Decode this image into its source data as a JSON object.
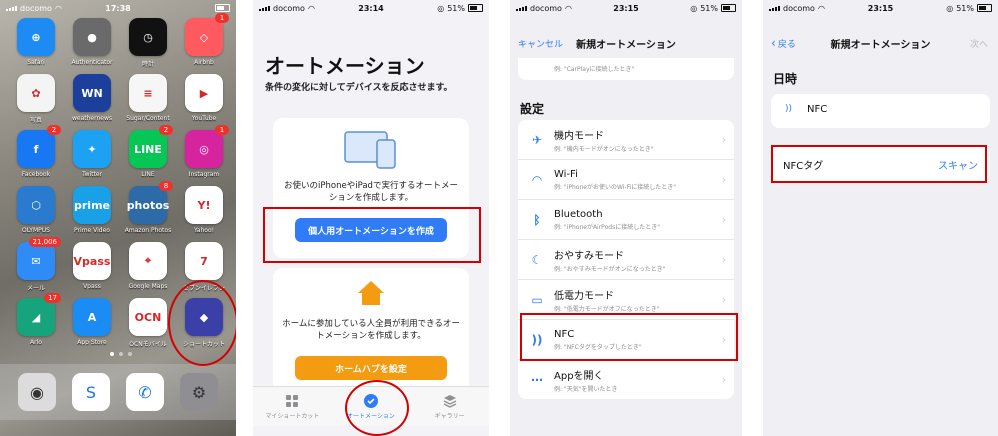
{
  "panel1": {
    "status": {
      "carrier": "docomo",
      "time": "17:38"
    },
    "apps": [
      {
        "label": "Safari",
        "icon": "compass-icon",
        "bg": "#1e8bf5",
        "glyph": "⊕"
      },
      {
        "label": "Authenticator",
        "icon": "authenticator-icon",
        "bg": "#6a6a6a",
        "glyph": "●"
      },
      {
        "label": "時計",
        "icon": "clock-icon",
        "bg": "#111111",
        "glyph": "◷"
      },
      {
        "label": "Airbnb",
        "icon": "airbnb-icon",
        "bg": "#ff5a5f",
        "glyph": "◇",
        "badge": "1"
      },
      {
        "label": "写真",
        "icon": "photos-icon",
        "bg": "#f4f4f4",
        "glyph": "✿"
      },
      {
        "label": "weathernews",
        "icon": "weathernews-icon",
        "bg": "#1b3f9a",
        "glyph": "WN"
      },
      {
        "label": "Sugar/Content",
        "icon": "notes-icon",
        "bg": "#f6f6f6",
        "glyph": "≡"
      },
      {
        "label": "YouTube",
        "icon": "youtube-icon",
        "bg": "#ffffff",
        "glyph": "▶"
      },
      {
        "label": "Facebook",
        "icon": "facebook-icon",
        "bg": "#1877f2",
        "glyph": "f",
        "badge": "2"
      },
      {
        "label": "Twitter",
        "icon": "twitter-icon",
        "bg": "#1da1f2",
        "glyph": "✦"
      },
      {
        "label": "LINE",
        "icon": "line-icon",
        "bg": "#06c755",
        "glyph": "LINE",
        "badge": "2"
      },
      {
        "label": "Instagram",
        "icon": "instagram-icon",
        "bg": "#d6249f",
        "glyph": "◎",
        "badge": "1"
      },
      {
        "label": "OLYMPUS",
        "icon": "olympus-icon",
        "bg": "#2a7bd0",
        "glyph": "⬡"
      },
      {
        "label": "Prime Video",
        "icon": "prime-video-icon",
        "bg": "#1aa0e6",
        "glyph": "prime"
      },
      {
        "label": "Amazon Photos",
        "icon": "amazon-photos-icon",
        "bg": "#2c6aa8",
        "glyph": "photos",
        "badge": "8"
      },
      {
        "label": "Yahoo!",
        "icon": "yahoo-icon",
        "bg": "#ffffff",
        "glyph": "Y!"
      },
      {
        "label": "メール",
        "icon": "mail-icon",
        "bg": "#2f8bf6",
        "glyph": "✉",
        "badge": "21,006"
      },
      {
        "label": "Vpass",
        "icon": "vpass-icon",
        "bg": "#ffffff",
        "glyph": "Vpass"
      },
      {
        "label": "Google Maps",
        "icon": "google-maps-icon",
        "bg": "#ffffff",
        "glyph": "⌖"
      },
      {
        "label": "セブンイレブン",
        "icon": "seven-eleven-icon",
        "bg": "#ffffff",
        "glyph": "7"
      },
      {
        "label": "Arlo",
        "icon": "arlo-icon",
        "bg": "#17a37c",
        "glyph": "◢",
        "badge": "17"
      },
      {
        "label": "App Store",
        "icon": "app-store-icon",
        "bg": "#1a8cf4",
        "glyph": "A"
      },
      {
        "label": "OCNモバイル",
        "icon": "ocn-mobile-icon",
        "bg": "#ffffff",
        "glyph": "OCN"
      },
      {
        "label": "ショートカット",
        "icon": "shortcuts-icon",
        "bg": "#3b3fa8",
        "glyph": "◆"
      }
    ],
    "dock": [
      {
        "icon": "camera-icon",
        "bg": "#dcdcdc",
        "glyph": "◉"
      },
      {
        "icon": "swipe-s-icon",
        "bg": "#ffffff",
        "glyph": "S"
      },
      {
        "icon": "ocn-phone-icon",
        "bg": "#ffffff",
        "glyph": "✆"
      },
      {
        "icon": "settings-icon",
        "bg": "#8e8e93",
        "glyph": "⚙"
      }
    ]
  },
  "panel2": {
    "status": {
      "carrier": "docomo",
      "time": "23:14",
      "battery": "51%"
    },
    "title": "オートメーション",
    "subtitle": "条件の変化に対してデバイスを反応させます。",
    "personal_text": "お使いのiPhoneやiPadで実行するオートメーションを作成します。",
    "personal_button": "個人用オートメーションを作成",
    "home_text": "ホームに参加している人全員が利用できるオートメーションを作成します。",
    "home_button": "ホームハブを設定",
    "tabs": [
      {
        "label": "マイショートカット",
        "icon": "grid-icon"
      },
      {
        "label": "オートメーション",
        "icon": "automation-icon"
      },
      {
        "label": "ギャラリー",
        "icon": "layers-icon"
      }
    ]
  },
  "panel3": {
    "status": {
      "carrier": "docomo",
      "time": "23:15",
      "battery": "51%"
    },
    "nav": {
      "cancel": "キャンセル",
      "title": "新規オートメーション"
    },
    "top_example": "例: \"CarPlayに接続したとき\"",
    "section": "設定",
    "rows": [
      {
        "title": "機内モード",
        "example": "例: \"機内モードがオンになったとき\"",
        "icon": "airplane-icon",
        "color": "#2f7cf6",
        "glyph": "✈"
      },
      {
        "title": "Wi-Fi",
        "example": "例: \"iPhoneがお使いのWi-Fiに接続したとき\"",
        "icon": "wifi-icon",
        "color": "#2f7cf6",
        "glyph": "◠"
      },
      {
        "title": "Bluetooth",
        "example": "例: \"iPhoneがAirPodsに接続したとき\"",
        "icon": "bluetooth-icon",
        "color": "#2f7cf6",
        "glyph": "ᛒ"
      },
      {
        "title": "おやすみモード",
        "example": "例: \"おやすみモードがオンになったとき\"",
        "icon": "moon-icon",
        "color": "#2f7cf6",
        "glyph": "☾"
      },
      {
        "title": "低電力モード",
        "example": "例: \"低電力モードがオフになったとき\"",
        "icon": "battery-icon",
        "color": "#2f7cf6",
        "glyph": "▭"
      },
      {
        "title": "NFC",
        "example": "例: \"NFCタグをタップしたとき\"",
        "icon": "nfc-icon",
        "color": "#2f7cf6",
        "glyph": "))"
      },
      {
        "title": "Appを開く",
        "example": "例: \"天気\"を開いたとき",
        "icon": "app-grid-icon",
        "color": "#2f7cf6",
        "glyph": "⋯"
      }
    ]
  },
  "panel4": {
    "status": {
      "carrier": "docomo",
      "time": "23:15",
      "battery": "51%"
    },
    "nav": {
      "back": "戻る",
      "title": "新規オートメーション",
      "next": "次へ"
    },
    "section": "日時",
    "trigger": "NFC",
    "tag_label": "NFCタグ",
    "scan": "スキャン"
  }
}
